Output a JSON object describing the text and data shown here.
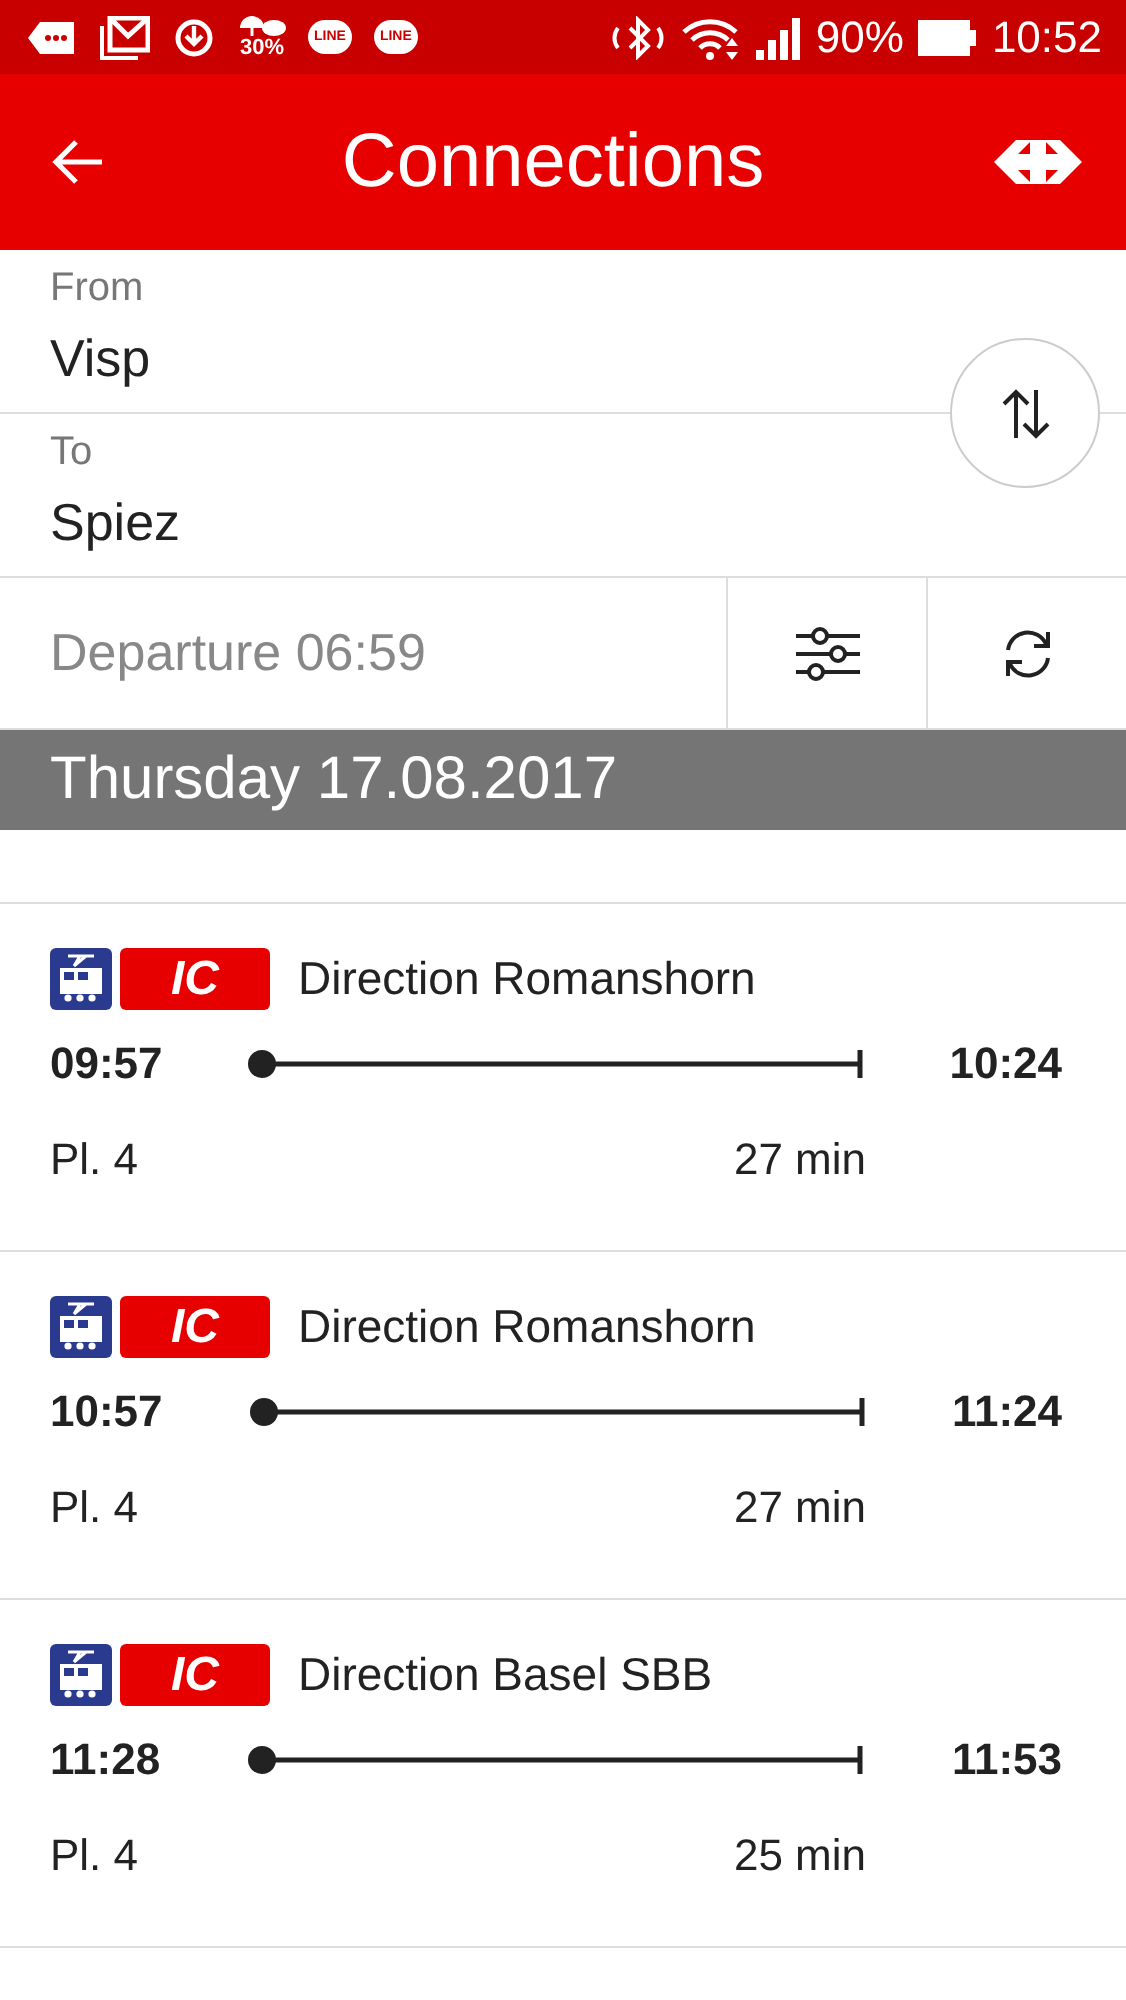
{
  "status_bar": {
    "weather": "30%",
    "chat_badges": [
      "LINE",
      "LINE"
    ],
    "battery": "90%",
    "time": "10:52"
  },
  "header": {
    "title": "Connections"
  },
  "from": {
    "label": "From",
    "value": "Visp"
  },
  "to": {
    "label": "To",
    "value": "Spiez"
  },
  "departure": {
    "value": "Departure 06:59"
  },
  "date_header": "Thursday 17.08.2017",
  "connections": [
    {
      "category": "IC",
      "direction": "Direction Romanshorn",
      "depart": "09:57",
      "arrive": "10:24",
      "platform": "Pl. 4",
      "duration": "27 min"
    },
    {
      "category": "IC",
      "direction": "Direction Romanshorn",
      "depart": "10:57",
      "arrive": "11:24",
      "platform": "Pl. 4",
      "duration": "27 min"
    },
    {
      "category": "IC",
      "direction": "Direction Basel SBB",
      "depart": "11:28",
      "arrive": "11:53",
      "platform": "Pl. 4",
      "duration": "25 min"
    }
  ]
}
